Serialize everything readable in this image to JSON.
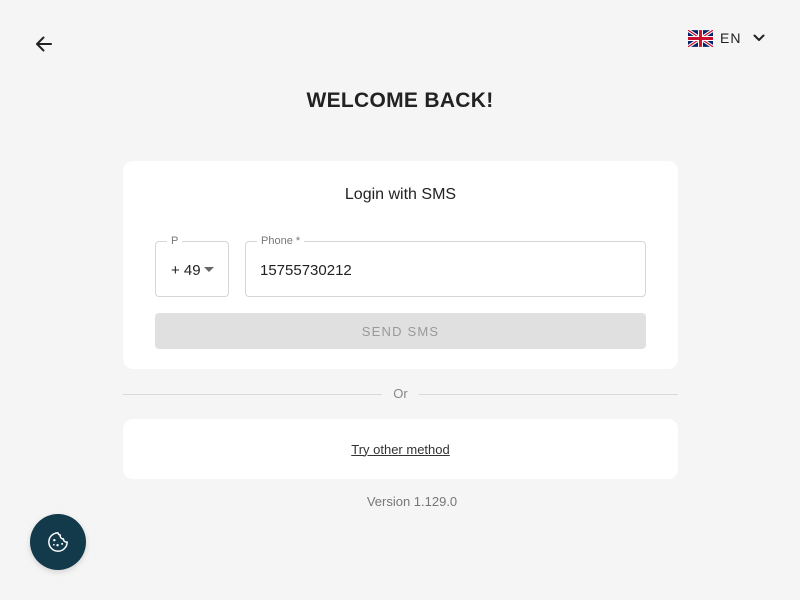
{
  "header": {
    "back_icon": "arrow-left-icon",
    "language": {
      "flag_icon": "uk-flag-icon",
      "code": "EN",
      "chevron_icon": "chevron-down-icon"
    }
  },
  "title": "WELCOME BACK!",
  "login_card": {
    "title": "Login with SMS",
    "prefix_field": {
      "label": "P",
      "value": "+ 49"
    },
    "phone_field": {
      "label": "Phone *",
      "value": "15755730212"
    },
    "send_button": "SEND SMS"
  },
  "divider": {
    "text": "Or"
  },
  "other_method": {
    "link": "Try other method"
  },
  "version": "Version 1.129.0",
  "cookie": {
    "icon": "cookie-icon"
  },
  "colors": {
    "background": "#f5f5f5",
    "card": "#ffffff",
    "button_disabled": "#e0e0e0",
    "cookie_button": "#123a4b"
  }
}
